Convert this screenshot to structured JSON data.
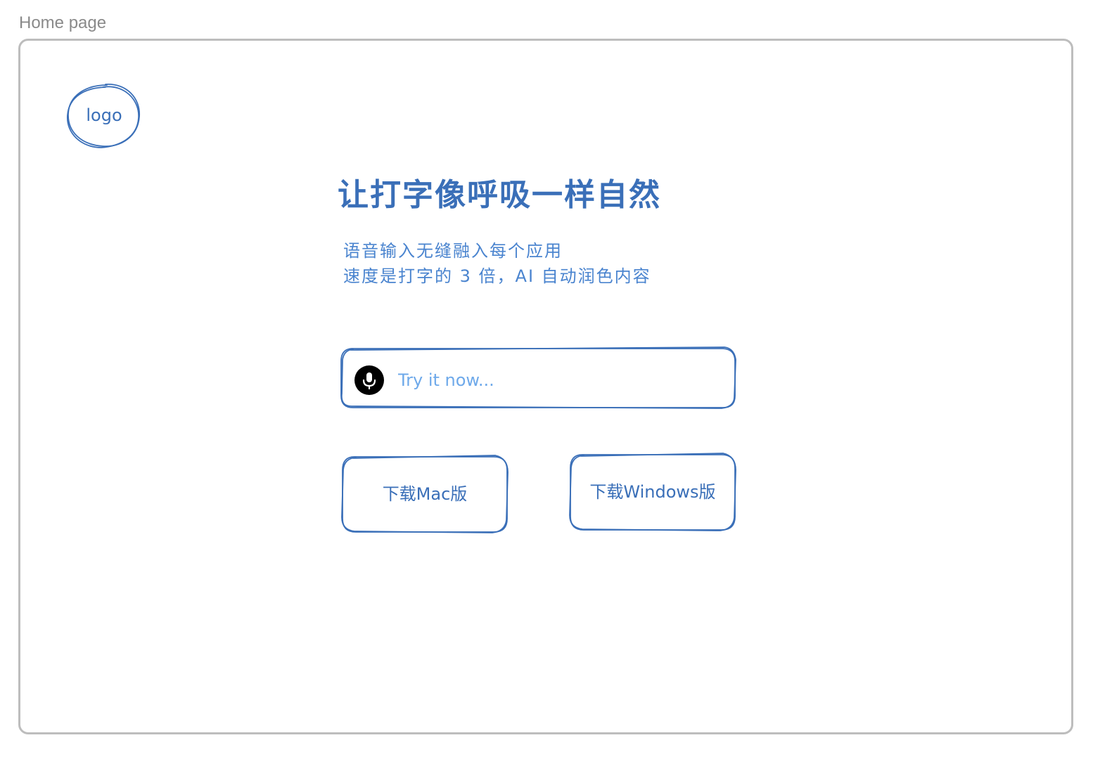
{
  "frame": {
    "label": "Home page"
  },
  "logo": {
    "text": "logo"
  },
  "hero": {
    "headline": "让打字像呼吸一样自然",
    "subline_1": "语音输入无缝融入每个应用",
    "subline_2": "速度是打字的 3 倍，AI 自动润色内容"
  },
  "try_input": {
    "placeholder": "Try it now...",
    "mic_icon": "microphone-icon"
  },
  "downloads": {
    "mac_label": "下载Mac版",
    "windows_label": "下载Windows版"
  },
  "colors": {
    "stroke": "#3a6fb8",
    "text": "#3a6fb8",
    "subtext": "#4a84cf",
    "placeholder": "#6ea9ea",
    "frame_border": "#bdbdbd",
    "frame_label": "#8a8a8a"
  }
}
